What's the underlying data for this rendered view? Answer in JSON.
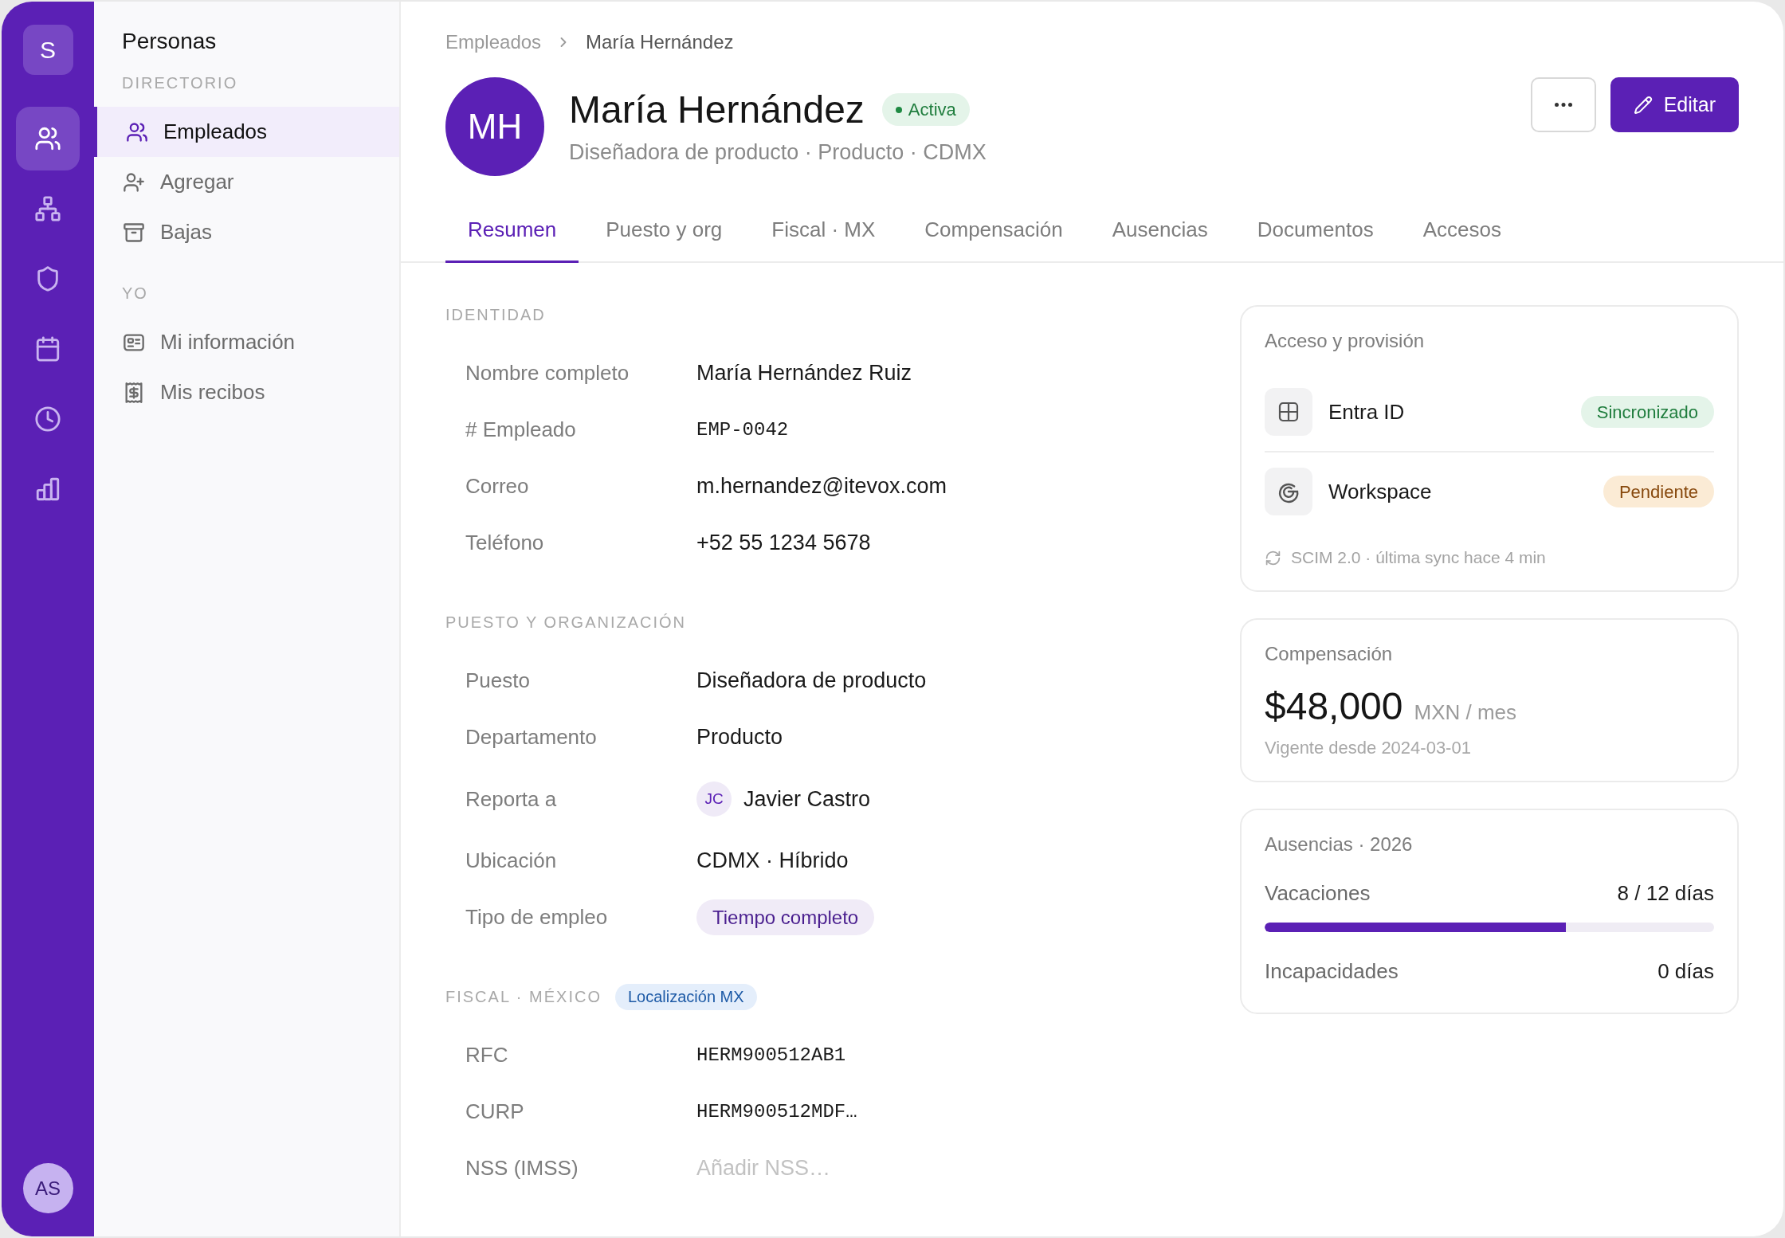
{
  "rail": {
    "logo": "S",
    "items": [
      {
        "selected": true
      },
      {
        "selected": false
      },
      {
        "selected": false
      },
      {
        "selected": false
      },
      {
        "selected": false
      },
      {
        "selected": false
      }
    ],
    "user_initials": "AS"
  },
  "sidebar": {
    "title": "Personas",
    "sections": [
      {
        "heading": "DIRECTORIO",
        "items": [
          {
            "label": "Empleados",
            "selected": true
          },
          {
            "label": "Agregar",
            "selected": false
          },
          {
            "label": "Bajas",
            "selected": false
          }
        ]
      },
      {
        "heading": "YO",
        "items": [
          {
            "label": "Mi información",
            "selected": false
          },
          {
            "label": "Mis recibos",
            "selected": false
          }
        ]
      }
    ]
  },
  "breadcrumb": {
    "parent": "Empleados",
    "current": "María Hernández"
  },
  "profile": {
    "initials": "MH",
    "name": "María Hernández",
    "status": {
      "label": "Activa",
      "kind": "success"
    },
    "subtitle": "Diseñadora de producto · Producto · CDMX"
  },
  "actions": {
    "edit": "Editar"
  },
  "tabs": [
    {
      "label": "Resumen",
      "selected": true
    },
    {
      "label": "Puesto y org",
      "selected": false
    },
    {
      "label": "Fiscal · MX",
      "selected": false
    },
    {
      "label": "Compensación",
      "selected": false
    },
    {
      "label": "Ausencias",
      "selected": false
    },
    {
      "label": "Documentos",
      "selected": false
    },
    {
      "label": "Accesos",
      "selected": false
    }
  ],
  "sections": [
    {
      "heading": "IDENTIDAD",
      "rows": [
        {
          "kind": "text",
          "label": "Nombre completo",
          "value": "María Hernández Ruiz"
        },
        {
          "kind": "mono",
          "label": "# Empleado",
          "value": "EMP-0042"
        },
        {
          "kind": "text",
          "label": "Correo",
          "value": "m.hernandez@itevox.com"
        },
        {
          "kind": "text",
          "label": "Teléfono",
          "value": "+52 55 1234 5678"
        }
      ]
    },
    {
      "heading": "PUESTO Y ORGANIZACIÓN",
      "rows": [
        {
          "kind": "text",
          "label": "Puesto",
          "value": "Diseñadora de producto"
        },
        {
          "kind": "text",
          "label": "Departamento",
          "value": "Producto"
        },
        {
          "kind": "person",
          "label": "Reporta a",
          "initials": "JC",
          "value": "Javier Castro"
        },
        {
          "kind": "text",
          "label": "Ubicación",
          "value": "CDMX · Híbrido"
        },
        {
          "kind": "tag",
          "label": "Tipo de empleo",
          "value": "Tiempo completo"
        }
      ]
    },
    {
      "heading": "FISCAL · MÉXICO",
      "badge": "Localización MX",
      "rows": [
        {
          "kind": "mono",
          "label": "RFC",
          "value": "HERM900512AB1"
        },
        {
          "kind": "mono",
          "label": "CURP",
          "value": "HERM900512MDF…"
        },
        {
          "kind": "input",
          "label": "NSS (IMSS)",
          "placeholder": "Añadir NSS…"
        }
      ]
    }
  ],
  "access_card": {
    "title": "Acceso y provisión",
    "services": [
      {
        "name": "Entra ID",
        "status": {
          "label": "Sincronizado",
          "kind": "success"
        }
      },
      {
        "name": "Workspace",
        "status": {
          "label": "Pendiente",
          "kind": "warning"
        }
      }
    ],
    "footer": "SCIM 2.0 · última sync hace 4 min"
  },
  "compensation_card": {
    "title": "Compensación",
    "amount": "$48,000",
    "unit": "MXN / mes",
    "effective": "Vigente desde 2024-03-01"
  },
  "absences_card": {
    "title": "Ausencias · 2026",
    "items": [
      {
        "kind": "progress",
        "label": "Vacaciones",
        "value": "8 / 12 días",
        "level": 0.67
      },
      {
        "kind": "plain",
        "label": "Incapacidades",
        "value": "0 días"
      }
    ]
  }
}
